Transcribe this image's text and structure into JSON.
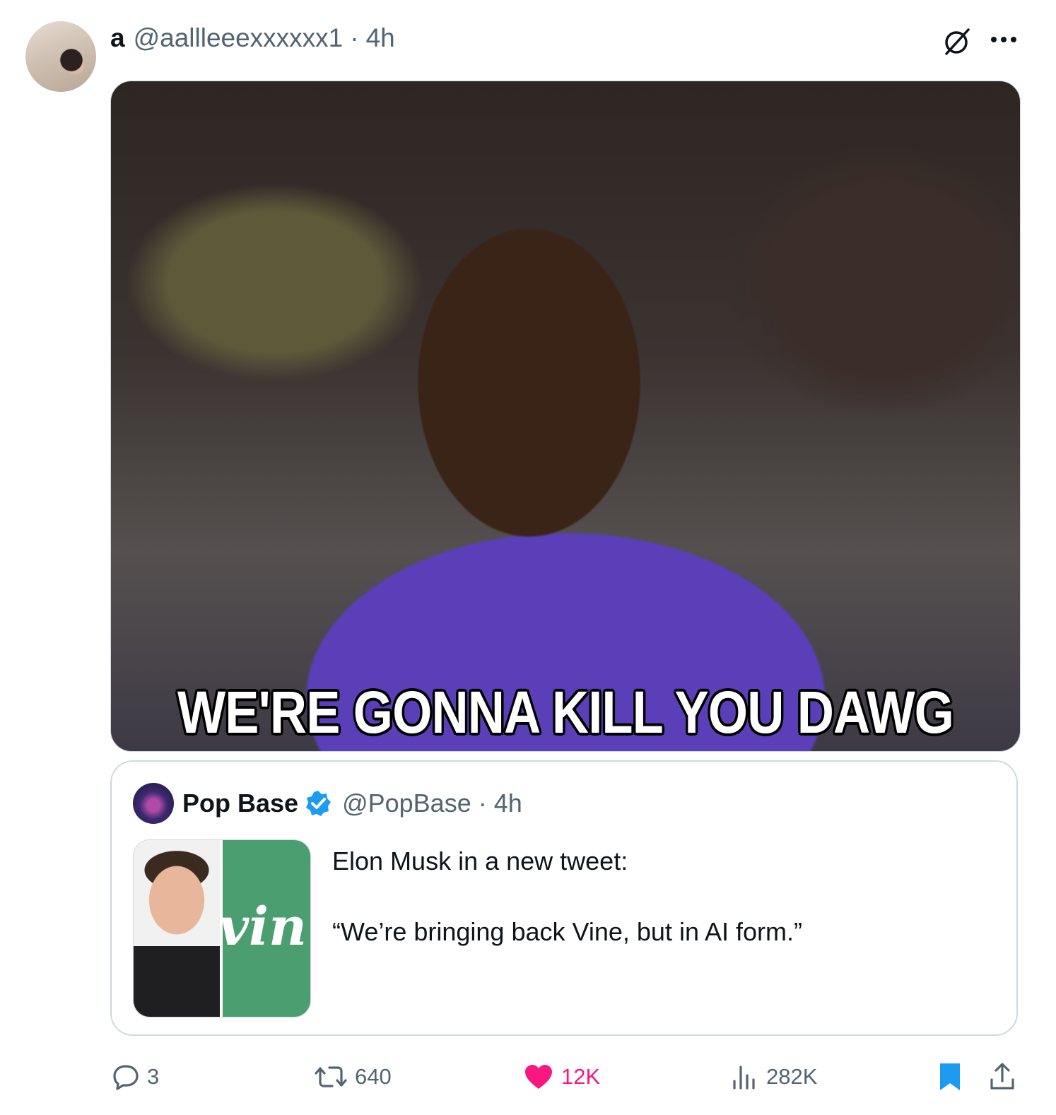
{
  "tweet": {
    "author": {
      "display_name": "a",
      "handle": "@aallleeexxxxxx1",
      "separator": "·",
      "time": "4h"
    },
    "media": {
      "caption": "WE'RE GONNA KILL YOU DAWG"
    },
    "quote": {
      "display_name": "Pop Base",
      "handle": "@PopBase",
      "separator": "·",
      "time": "4h",
      "text_line1": "Elon Musk in a new tweet:",
      "text_line2": "“We’re bringing back Vine, but in AI form.”",
      "thumb_logo_text": "vin"
    },
    "actions": {
      "reply_count": "3",
      "retweet_count": "640",
      "like_count": "12K",
      "views_count": "282K"
    },
    "icons": {
      "grok": "grok-icon",
      "more": "more-icon",
      "verified": "verified-badge-icon",
      "reply": "reply-icon",
      "retweet": "retweet-icon",
      "like": "heart-icon",
      "views": "views-icon",
      "bookmark": "bookmark-icon",
      "share": "share-icon"
    },
    "colors": {
      "secondary_text": "#536471",
      "like_active": "#f91880",
      "bookmark_active": "#1d9bf0",
      "verified": "#1d9bf0"
    }
  }
}
